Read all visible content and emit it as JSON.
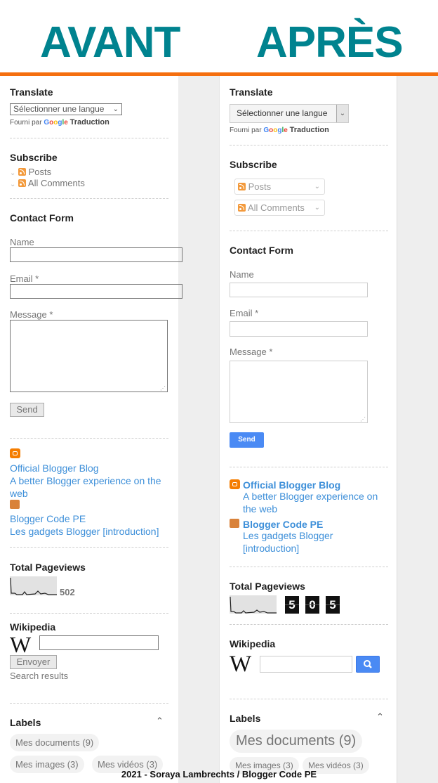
{
  "header": {
    "before": "AVANT",
    "after": "APRÈS"
  },
  "colors": {
    "title_teal": "#00838f",
    "accent_orange": "#f56f0f",
    "link_blue": "#3d8fd9",
    "send_blue": "#4a8af4"
  },
  "translate": {
    "title": "Translate",
    "select_value": "Sélectionner une langue",
    "powered_prefix": "Fourni par",
    "google": [
      "G",
      "o",
      "o",
      "g",
      "l",
      "e"
    ],
    "powered_suffix": "Traduction"
  },
  "subscribe": {
    "title": "Subscribe",
    "items": [
      {
        "label": "Posts",
        "icon": "rss-icon"
      },
      {
        "label": "All Comments",
        "icon": "rss-icon"
      }
    ]
  },
  "contact": {
    "title": "Contact Form",
    "name_label": "Name",
    "email_label": "Email *",
    "message_label": "Message *",
    "send_label": "Send"
  },
  "bloglist": {
    "items": [
      {
        "blog": "Official Blogger Blog",
        "post_before": "A better Blogger experience on the web",
        "after_line1": "A better Blogger experience on",
        "after_line2": "the web",
        "icon": "blogger-icon"
      },
      {
        "blog": "Blogger Code PE",
        "post_before": "Les gadgets Blogger [introduction]",
        "after_line1": "Les gadgets Blogger",
        "after_line2": "[introduction]",
        "icon": "blogger-code-pe-icon"
      }
    ]
  },
  "pageviews": {
    "title": "Total Pageviews",
    "before_count": "502",
    "after_digits": [
      "5",
      "0",
      "5"
    ]
  },
  "wikipedia": {
    "title": "Wikipedia",
    "logo": "W",
    "submit_label": "Envoyer",
    "results_label": "Search results"
  },
  "labels": {
    "title": "Labels",
    "items": [
      "Mes documents (9)",
      "Mes images (3)",
      "Mes vidéos (3)"
    ]
  },
  "footer": "2021 - Soraya Lambrechts / Blogger Code PE"
}
